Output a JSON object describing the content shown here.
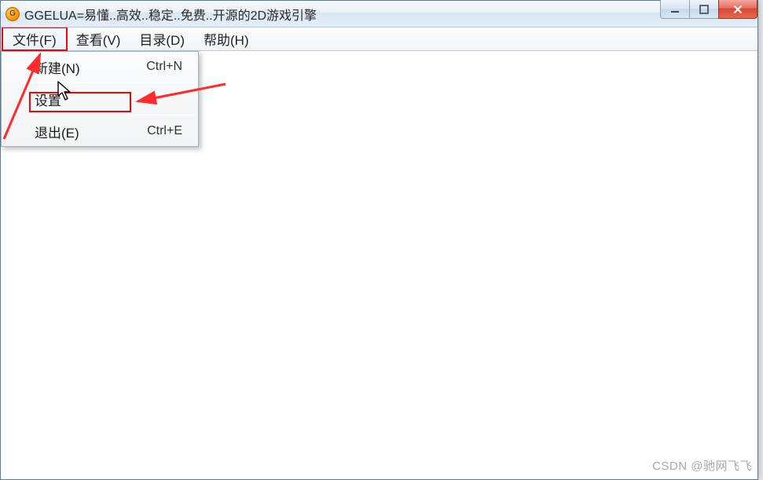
{
  "titlebar": {
    "icon_name": "app-icon",
    "title": "GGELUA=易懂..高效..稳定..免费..开源的2D游戏引擎"
  },
  "window_controls": {
    "minimize": "minimize",
    "maximize": "maximize",
    "close": "close"
  },
  "menubar": {
    "items": [
      {
        "label": "文件(F)",
        "active": true
      },
      {
        "label": "查看(V)",
        "active": false
      },
      {
        "label": "目录(D)",
        "active": false
      },
      {
        "label": "帮助(H)",
        "active": false
      }
    ]
  },
  "dropdown": {
    "items": [
      {
        "label": "新建(N)",
        "shortcut": "Ctrl+N"
      },
      {
        "label": "设置",
        "shortcut": ""
      },
      {
        "label": "退出(E)",
        "shortcut": "Ctrl+E"
      }
    ]
  },
  "annotations": {
    "highlight_menu": "file-menu",
    "highlight_dropdown_item": "settings",
    "arrow_color": "#ff2a2a"
  },
  "watermark": "CSDN @驰网飞飞"
}
